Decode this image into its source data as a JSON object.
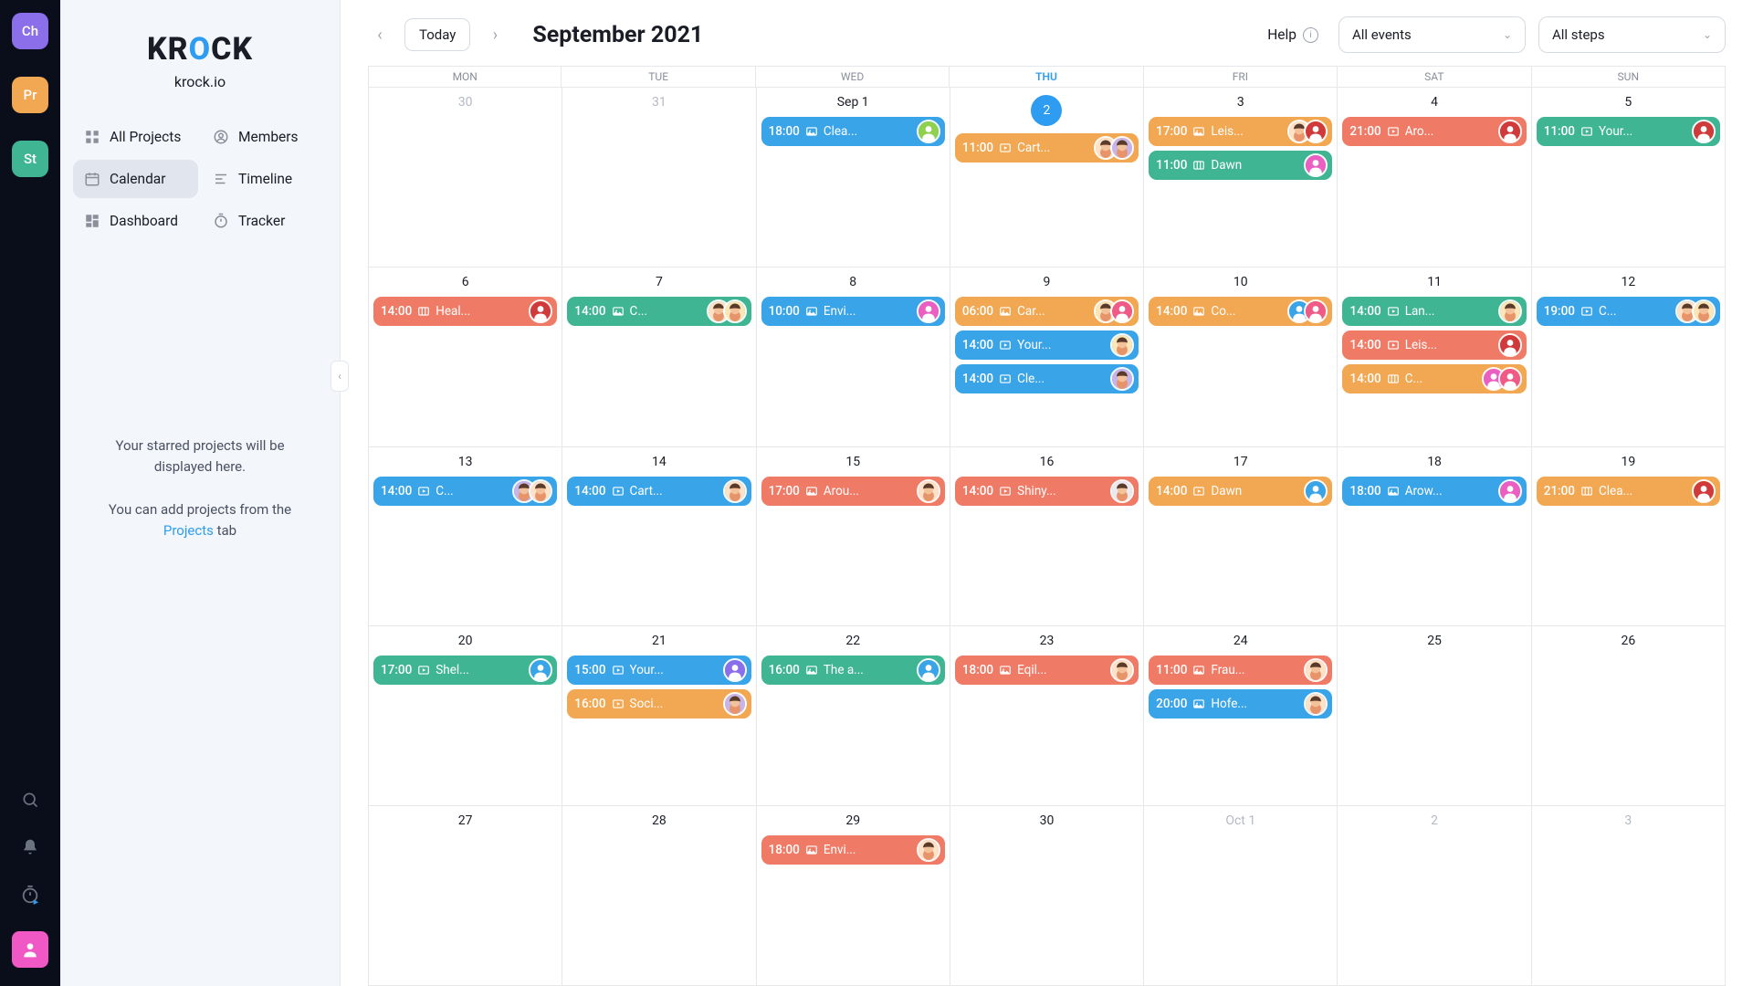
{
  "rail": {
    "chips": [
      {
        "label": "Ch",
        "bg": "#8a6eea"
      },
      {
        "label": "Pr",
        "bg": "#f2a752"
      },
      {
        "label": "St",
        "bg": "#3fb593"
      }
    ]
  },
  "sidebar": {
    "logo": {
      "pre": "KR",
      "o": "O",
      "post": "CK"
    },
    "subtitle": "krock.io",
    "nav": [
      {
        "label": "All Projects",
        "icon": "grid"
      },
      {
        "label": "Members",
        "icon": "members"
      },
      {
        "label": "Calendar",
        "icon": "calendar",
        "active": true
      },
      {
        "label": "Timeline",
        "icon": "timeline"
      },
      {
        "label": "Dashboard",
        "icon": "dashboard"
      },
      {
        "label": "Tracker",
        "icon": "tracker"
      }
    ],
    "starred": {
      "l1": "Your starred projects will be displayed here.",
      "l2a": "You can add projects from the ",
      "link": "Projects",
      "l2b": " tab"
    }
  },
  "topbar": {
    "today": "Today",
    "month": "September 2021",
    "help": "Help",
    "select1": "All events",
    "select2": "All steps"
  },
  "dayHeaders": [
    "MON",
    "TUE",
    "WED",
    "THU",
    "FRI",
    "SAT",
    "SUN"
  ],
  "todayCol": 3,
  "cells": [
    {
      "num": "30",
      "dim": true,
      "events": []
    },
    {
      "num": "31",
      "dim": true,
      "events": []
    },
    {
      "num": "Sep 1",
      "events": [
        {
          "time": "18:00",
          "ic": "img",
          "label": "Clea...",
          "color": "c-blue",
          "avs": [
            {
              "bg": "#8fd14f",
              "ic": "user"
            }
          ]
        }
      ]
    },
    {
      "num": "2",
      "today": true,
      "events": [
        {
          "time": "11:00",
          "ic": "vid",
          "label": "Cart...",
          "color": "c-orange",
          "avs": [
            {
              "bg": "#fde2c8",
              "face": true
            },
            {
              "bg": "#c7b5ea",
              "face": true
            }
          ]
        }
      ]
    },
    {
      "num": "3",
      "events": [
        {
          "time": "17:00",
          "ic": "img",
          "label": "Leis...",
          "color": "c-orange",
          "avs": [
            {
              "bg": "#fde2c8",
              "face": true
            },
            {
              "bg": "#d13a3a",
              "ic": "user"
            }
          ]
        },
        {
          "time": "11:00",
          "ic": "slides",
          "label": "Dawn",
          "color": "c-green",
          "avs": [
            {
              "bg": "#eb5fc2",
              "ic": "user"
            }
          ]
        }
      ]
    },
    {
      "num": "4",
      "events": [
        {
          "time": "21:00",
          "ic": "vid",
          "label": "Aro...",
          "color": "c-coral",
          "avs": [
            {
              "bg": "#d13a3a",
              "ic": "user"
            }
          ]
        }
      ]
    },
    {
      "num": "5",
      "events": [
        {
          "time": "11:00",
          "ic": "vid",
          "label": "Your...",
          "color": "c-green",
          "avs": [
            {
              "bg": "#d13a3a",
              "ic": "user"
            }
          ]
        }
      ]
    },
    {
      "num": "6",
      "events": [
        {
          "time": "14:00",
          "ic": "slides",
          "label": "Heal...",
          "color": "c-coral",
          "avs": [
            {
              "bg": "#d13a3a",
              "ic": "user"
            }
          ]
        }
      ]
    },
    {
      "num": "7",
      "events": [
        {
          "time": "14:00",
          "ic": "img",
          "label": "C...",
          "color": "c-green",
          "avs": [
            {
              "bg": "#fde2c8",
              "face": true
            },
            {
              "bg": "#fbe6b8",
              "face": true
            }
          ]
        }
      ]
    },
    {
      "num": "8",
      "events": [
        {
          "time": "10:00",
          "ic": "img",
          "label": "Envi...",
          "color": "c-blue",
          "avs": [
            {
              "bg": "#eb5fc2",
              "ic": "user"
            }
          ]
        }
      ]
    },
    {
      "num": "9",
      "events": [
        {
          "time": "06:00",
          "ic": "img",
          "label": "Car...",
          "color": "c-orange",
          "avs": [
            {
              "bg": "#fbe6b8",
              "face": true
            },
            {
              "bg": "#ef5a86",
              "ic": "user"
            }
          ]
        },
        {
          "time": "14:00",
          "ic": "vid",
          "label": "Your...",
          "color": "c-blue",
          "avs": [
            {
              "bg": "#fbe6b8",
              "face": true
            }
          ]
        },
        {
          "time": "14:00",
          "ic": "vid",
          "label": "Cle...",
          "color": "c-blue",
          "avs": [
            {
              "bg": "#c7b5ea",
              "face": true
            }
          ]
        }
      ]
    },
    {
      "num": "10",
      "events": [
        {
          "time": "14:00",
          "ic": "img",
          "label": "Co...",
          "color": "c-orange",
          "avs": [
            {
              "bg": "#3aa4e8",
              "ic": "user"
            },
            {
              "bg": "#ef5a86",
              "ic": "user"
            }
          ]
        }
      ]
    },
    {
      "num": "11",
      "events": [
        {
          "time": "14:00",
          "ic": "vid",
          "label": "Lan...",
          "color": "c-green",
          "avs": [
            {
              "bg": "#fbe6b8",
              "face": true
            }
          ]
        },
        {
          "time": "14:00",
          "ic": "vid",
          "label": "Leis...",
          "color": "c-coral",
          "avs": [
            {
              "bg": "#d13a3a",
              "ic": "user"
            }
          ]
        },
        {
          "time": "14:00",
          "ic": "slides",
          "label": "C...",
          "color": "c-orange",
          "avs": [
            {
              "bg": "#eb5fc2",
              "ic": "user"
            },
            {
              "bg": "#ef5a86",
              "ic": "user"
            }
          ]
        }
      ]
    },
    {
      "num": "12",
      "events": [
        {
          "time": "19:00",
          "ic": "vid",
          "label": "C...",
          "color": "c-blue",
          "avs": [
            {
              "bg": "#fde2c8",
              "face": true
            },
            {
              "bg": "#fbe6b8",
              "face": true
            }
          ]
        }
      ]
    },
    {
      "num": "13",
      "events": [
        {
          "time": "14:00",
          "ic": "vid",
          "label": "C...",
          "color": "c-blue",
          "avs": [
            {
              "bg": "#c7b5ea",
              "face": true
            },
            {
              "bg": "#fde2c8",
              "face": true
            }
          ]
        }
      ]
    },
    {
      "num": "14",
      "events": [
        {
          "time": "14:00",
          "ic": "vid",
          "label": "Cart...",
          "color": "c-blue",
          "avs": [
            {
              "bg": "#fde2c8",
              "face": true
            }
          ]
        }
      ]
    },
    {
      "num": "15",
      "events": [
        {
          "time": "17:00",
          "ic": "img",
          "label": "Arou...",
          "color": "c-coral",
          "avs": [
            {
              "bg": "#fde2c8",
              "face": true
            }
          ]
        }
      ]
    },
    {
      "num": "16",
      "events": [
        {
          "time": "14:00",
          "ic": "vid",
          "label": "Shiny...",
          "color": "c-coral",
          "avs": [
            {
              "bg": "#e9ebf0",
              "face": true
            }
          ]
        }
      ]
    },
    {
      "num": "17",
      "events": [
        {
          "time": "14:00",
          "ic": "vid",
          "label": "Dawn",
          "color": "c-orange",
          "avs": [
            {
              "bg": "#3aa4e8",
              "ic": "user"
            }
          ]
        }
      ]
    },
    {
      "num": "18",
      "events": [
        {
          "time": "18:00",
          "ic": "img",
          "label": "Arow...",
          "color": "c-blue",
          "avs": [
            {
              "bg": "#eb5fc2",
              "ic": "user"
            }
          ]
        }
      ]
    },
    {
      "num": "19",
      "events": [
        {
          "time": "21:00",
          "ic": "slides",
          "label": "Clea...",
          "color": "c-orange",
          "avs": [
            {
              "bg": "#d13a3a",
              "ic": "user"
            }
          ]
        }
      ]
    },
    {
      "num": "20",
      "events": [
        {
          "time": "17:00",
          "ic": "vid",
          "label": "Shel...",
          "color": "c-green",
          "avs": [
            {
              "bg": "#3aa4e8",
              "ic": "user"
            }
          ]
        }
      ]
    },
    {
      "num": "21",
      "events": [
        {
          "time": "15:00",
          "ic": "vid",
          "label": "Your...",
          "color": "c-blue",
          "avs": [
            {
              "bg": "#8a6eea",
              "ic": "user"
            }
          ]
        },
        {
          "time": "16:00",
          "ic": "vid",
          "label": "Soci...",
          "color": "c-orange",
          "avs": [
            {
              "bg": "#c7b5ea",
              "face": true
            }
          ]
        }
      ]
    },
    {
      "num": "22",
      "events": [
        {
          "time": "16:00",
          "ic": "img",
          "label": "The a...",
          "color": "c-green",
          "avs": [
            {
              "bg": "#3aa4e8",
              "ic": "user"
            }
          ]
        }
      ]
    },
    {
      "num": "23",
      "events": [
        {
          "time": "18:00",
          "ic": "img",
          "label": "Eqil...",
          "color": "c-coral",
          "avs": [
            {
              "bg": "#fde2c8",
              "face": true
            }
          ]
        }
      ]
    },
    {
      "num": "24",
      "events": [
        {
          "time": "11:00",
          "ic": "img",
          "label": "Frau...",
          "color": "c-coral",
          "avs": [
            {
              "bg": "#fde2c8",
              "face": true
            }
          ]
        },
        {
          "time": "20:00",
          "ic": "img",
          "label": "Hofe...",
          "color": "c-blue",
          "avs": [
            {
              "bg": "#fde2c8",
              "face": true
            }
          ]
        }
      ]
    },
    {
      "num": "25",
      "events": []
    },
    {
      "num": "26",
      "events": []
    },
    {
      "num": "27",
      "events": []
    },
    {
      "num": "28",
      "events": []
    },
    {
      "num": "29",
      "events": [
        {
          "time": "18:00",
          "ic": "img",
          "label": "Envi...",
          "color": "c-coral",
          "avs": [
            {
              "bg": "#fde2c8",
              "face": true
            }
          ]
        }
      ]
    },
    {
      "num": "30",
      "events": []
    },
    {
      "num": "Oct 1",
      "dim": true,
      "events": []
    },
    {
      "num": "2",
      "dim": true,
      "events": []
    },
    {
      "num": "3",
      "dim": true,
      "events": []
    }
  ]
}
